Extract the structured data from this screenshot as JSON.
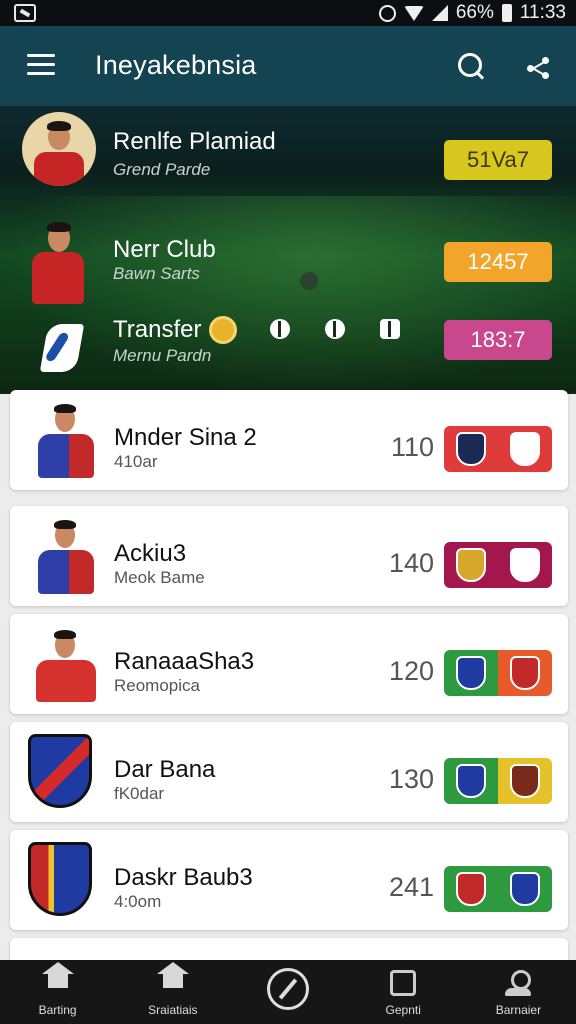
{
  "status_bar": {
    "battery": "66%",
    "time": "11:33"
  },
  "header": {
    "title": "Ineyakebnsia"
  },
  "featured": [
    {
      "name": "Renlfe Plamiad",
      "sub": "Grend Parde",
      "value": "51Va7",
      "badge_color": "#d8c71f",
      "badge_text_color": "#3a3a10"
    },
    {
      "name": "Nerr Club",
      "sub": "Bawn Sarts",
      "value": "12457",
      "badge_color": "#f2a52a",
      "badge_text_color": "#ffffff"
    },
    {
      "name": "Transfer",
      "sub": "Mernu Pardn",
      "value": "183:7",
      "badge_color": "#c8478d",
      "badge_text_color": "#ffffff"
    }
  ],
  "list": [
    {
      "name": "Mnder Sina 2",
      "sub": "410ar",
      "score": "110",
      "left_color": "#e03b3b",
      "right_color": "#e03b3b",
      "shirt": "#2f3fa8",
      "shirt2": "#c22a2a",
      "kind": "player"
    },
    {
      "name": "Ackiu3",
      "sub": "Meok Bame",
      "score": "140",
      "left_color": "#a3174d",
      "right_color": "#a3174d",
      "shirt": "#2f3fa8",
      "shirt2": "#c22a2a",
      "kind": "player"
    },
    {
      "name": "RanaaaSha3",
      "sub": "Reomopica",
      "score": "120",
      "left_color": "#2e9a3f",
      "right_color": "#e85a2a",
      "shirt": "#d4312f",
      "shirt2": "#d4312f",
      "kind": "player"
    },
    {
      "name": "Dar Bana",
      "sub": "fK0dar",
      "score": "130",
      "left_color": "#2e9a3f",
      "right_color": "#e6c22a",
      "shirt": "#1f3aa0",
      "shirt2": "#c22a2a",
      "kind": "crest"
    },
    {
      "name": "Daskr Baub3",
      "sub": "4:0om",
      "score": "241",
      "left_color": "#2e9a3f",
      "right_color": "#2e9a3f",
      "shirt": "#c22a2a",
      "shirt2": "#1f3aa0",
      "kind": "crest"
    }
  ],
  "bottom_nav": [
    {
      "label": "Barting",
      "icon": "home-icon"
    },
    {
      "label": "Sraiatiais",
      "icon": "stadium-icon"
    },
    {
      "label": "",
      "icon": "whistle-icon"
    },
    {
      "label": "Gepnti",
      "icon": "stats-icon"
    },
    {
      "label": "Barnaier",
      "icon": "user-icon"
    }
  ]
}
